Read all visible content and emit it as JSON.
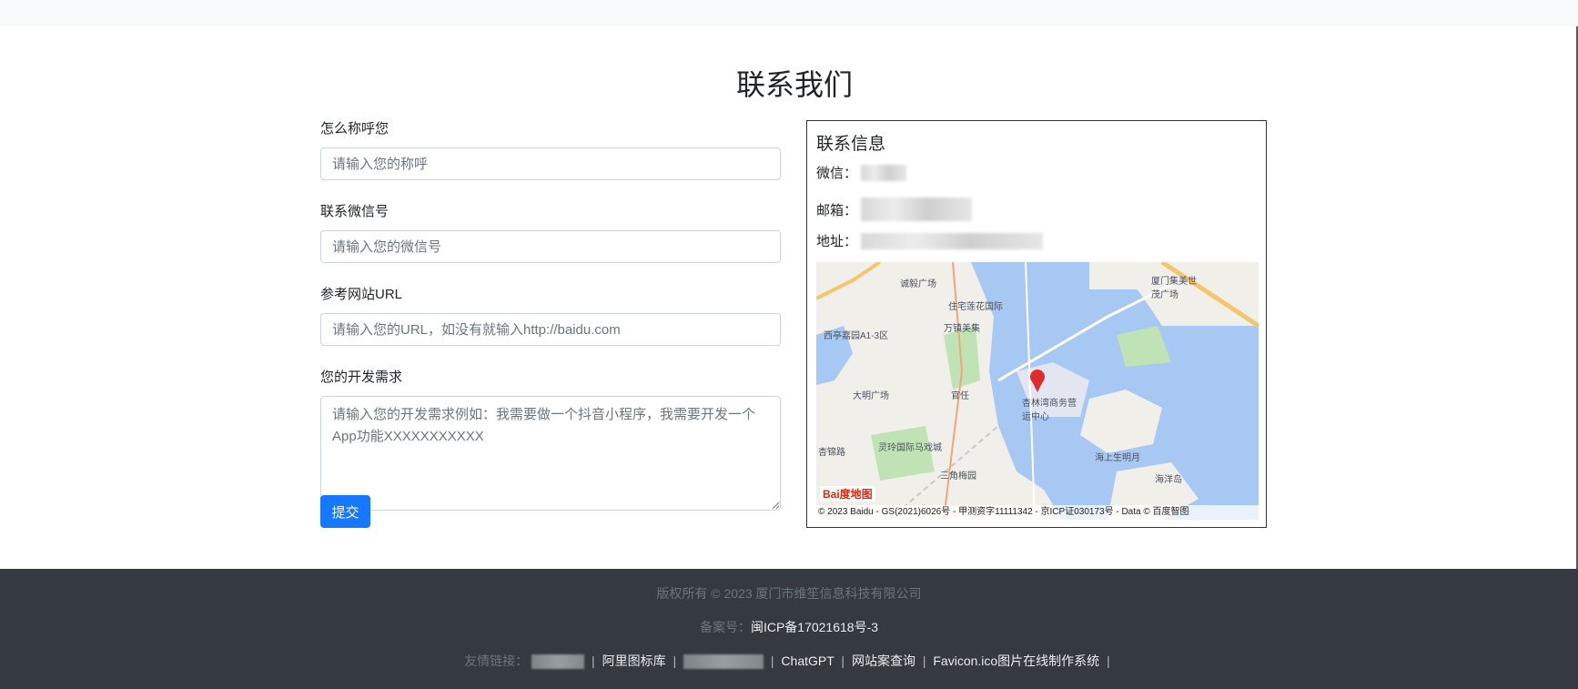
{
  "page": {
    "title": "联系我们"
  },
  "form": {
    "name_label": "怎么称呼您",
    "name_placeholder": "请输入您的称呼",
    "wechat_label": "联系微信号",
    "wechat_placeholder": "请输入您的微信号",
    "url_label": "参考网站URL",
    "url_placeholder": "请输入您的URL，如没有就输入http://baidu.com",
    "needs_label": "您的开发需求",
    "needs_placeholder": "请输入您的开发需求例如：我需要做一个抖音小程序，我需要开发一个App功能XXXXXXXXXXX",
    "submit_label": "提交"
  },
  "contact": {
    "title": "联系信息",
    "wechat_label": "微信：",
    "email_label": "邮箱：",
    "address_label": "地址："
  },
  "map": {
    "labels": [
      "诚毅广场",
      "住宅莲花国际",
      "万镇美集",
      "西亭嘉园A1-3区",
      "大明广场",
      "官任",
      "杏林湾商务营运中心",
      "灵玲国际马戏城",
      "海上生明月",
      "三角梅园",
      "海洋岛",
      "厦门集美世茂广场",
      "杏锦路"
    ],
    "baidu_logo": "Bai度地图",
    "copyright": "© 2023 Baidu - GS(2021)6026号 - 甲测资字11111342 - 京ICP证030173号 - Data © 百度智图",
    "colors": {
      "water": "#a7c8f2",
      "land": "#f1efe9",
      "park": "#bfe3b4",
      "road": "#f6c46b",
      "marker": "#e02b2b"
    }
  },
  "footer": {
    "copyright": "版权所有 © 2023 厦门市维笙信息科技有限公司",
    "beian_label": "备案号：",
    "beian_value": "闽ICP备17021618号-3",
    "links_label": "友情链接：",
    "links": [
      "阿里图标库",
      "ChatGPT",
      "网站案查询",
      "Favicon.ico图片在线制作系统"
    ],
    "separator": "|"
  }
}
